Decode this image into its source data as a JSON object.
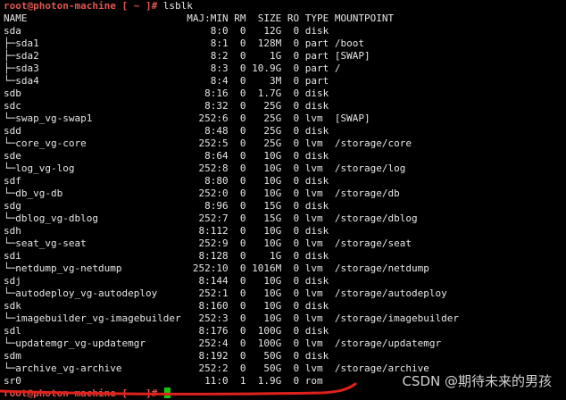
{
  "terminal": {
    "prompt": "root@photon-machine [ ~ ]#",
    "command": " lsblk",
    "final_prompt": "root@photon-machine [ ~ ]#",
    "columns": [
      "NAME",
      "MAJ:MIN",
      "RM",
      "SIZE",
      "RO",
      "TYPE",
      "MOUNTPOINT"
    ],
    "rows": [
      {
        "name": "sda",
        "majmin": "8:0",
        "rm": "0",
        "size": "12G",
        "ro": "0",
        "type": "disk",
        "mount": ""
      },
      {
        "name": "├─sda1",
        "majmin": "8:1",
        "rm": "0",
        "size": "128M",
        "ro": "0",
        "type": "part",
        "mount": "/boot"
      },
      {
        "name": "├─sda2",
        "majmin": "8:2",
        "rm": "0",
        "size": "1G",
        "ro": "0",
        "type": "part",
        "mount": "[SWAP]"
      },
      {
        "name": "├─sda3",
        "majmin": "8:3",
        "rm": "0",
        "size": "10.9G",
        "ro": "0",
        "type": "part",
        "mount": "/"
      },
      {
        "name": "└─sda4",
        "majmin": "8:4",
        "rm": "0",
        "size": "3M",
        "ro": "0",
        "type": "part",
        "mount": ""
      },
      {
        "name": "sdb",
        "majmin": "8:16",
        "rm": "0",
        "size": "1.7G",
        "ro": "0",
        "type": "disk",
        "mount": ""
      },
      {
        "name": "sdc",
        "majmin": "8:32",
        "rm": "0",
        "size": "25G",
        "ro": "0",
        "type": "disk",
        "mount": ""
      },
      {
        "name": "└─swap_vg-swap1",
        "majmin": "252:6",
        "rm": "0",
        "size": "25G",
        "ro": "0",
        "type": "lvm",
        "mount": "[SWAP]"
      },
      {
        "name": "sdd",
        "majmin": "8:48",
        "rm": "0",
        "size": "25G",
        "ro": "0",
        "type": "disk",
        "mount": ""
      },
      {
        "name": "└─core_vg-core",
        "majmin": "252:5",
        "rm": "0",
        "size": "25G",
        "ro": "0",
        "type": "lvm",
        "mount": "/storage/core"
      },
      {
        "name": "sde",
        "majmin": "8:64",
        "rm": "0",
        "size": "10G",
        "ro": "0",
        "type": "disk",
        "mount": ""
      },
      {
        "name": "└─log_vg-log",
        "majmin": "252:8",
        "rm": "0",
        "size": "10G",
        "ro": "0",
        "type": "lvm",
        "mount": "/storage/log"
      },
      {
        "name": "sdf",
        "majmin": "8:80",
        "rm": "0",
        "size": "10G",
        "ro": "0",
        "type": "disk",
        "mount": ""
      },
      {
        "name": "└─db_vg-db",
        "majmin": "252:0",
        "rm": "0",
        "size": "10G",
        "ro": "0",
        "type": "lvm",
        "mount": "/storage/db"
      },
      {
        "name": "sdg",
        "majmin": "8:96",
        "rm": "0",
        "size": "15G",
        "ro": "0",
        "type": "disk",
        "mount": ""
      },
      {
        "name": "└─dblog_vg-dblog",
        "majmin": "252:7",
        "rm": "0",
        "size": "15G",
        "ro": "0",
        "type": "lvm",
        "mount": "/storage/dblog"
      },
      {
        "name": "sdh",
        "majmin": "8:112",
        "rm": "0",
        "size": "10G",
        "ro": "0",
        "type": "disk",
        "mount": ""
      },
      {
        "name": "└─seat_vg-seat",
        "majmin": "252:9",
        "rm": "0",
        "size": "10G",
        "ro": "0",
        "type": "lvm",
        "mount": "/storage/seat"
      },
      {
        "name": "sdi",
        "majmin": "8:128",
        "rm": "0",
        "size": "1G",
        "ro": "0",
        "type": "disk",
        "mount": ""
      },
      {
        "name": "└─netdump_vg-netdump",
        "majmin": "252:10",
        "rm": "0",
        "size": "1016M",
        "ro": "0",
        "type": "lvm",
        "mount": "/storage/netdump"
      },
      {
        "name": "sdj",
        "majmin": "8:144",
        "rm": "0",
        "size": "10G",
        "ro": "0",
        "type": "disk",
        "mount": ""
      },
      {
        "name": "└─autodeploy_vg-autodeploy",
        "majmin": "252:1",
        "rm": "0",
        "size": "10G",
        "ro": "0",
        "type": "lvm",
        "mount": "/storage/autodeploy"
      },
      {
        "name": "sdk",
        "majmin": "8:160",
        "rm": "0",
        "size": "10G",
        "ro": "0",
        "type": "disk",
        "mount": ""
      },
      {
        "name": "└─imagebuilder_vg-imagebuilder",
        "majmin": "252:3",
        "rm": "0",
        "size": "10G",
        "ro": "0",
        "type": "lvm",
        "mount": "/storage/imagebuilder"
      },
      {
        "name": "sdl",
        "majmin": "8:176",
        "rm": "0",
        "size": "100G",
        "ro": "0",
        "type": "disk",
        "mount": ""
      },
      {
        "name": "└─updatemgr_vg-updatemgr",
        "majmin": "252:4",
        "rm": "0",
        "size": "100G",
        "ro": "0",
        "type": "lvm",
        "mount": "/storage/updatemgr"
      },
      {
        "name": "sdm",
        "majmin": "8:192",
        "rm": "0",
        "size": "50G",
        "ro": "0",
        "type": "disk",
        "mount": ""
      },
      {
        "name": "└─archive_vg-archive",
        "majmin": "252:2",
        "rm": "0",
        "size": "50G",
        "ro": "0",
        "type": "lvm",
        "mount": "/storage/archive"
      },
      {
        "name": "sr0",
        "majmin": "11:0",
        "rm": "1",
        "size": "1.9G",
        "ro": "0",
        "type": "rom",
        "mount": ""
      }
    ]
  },
  "watermark": "CSDN @期待未来的男孩",
  "colors": {
    "background": "#000000",
    "text": "#e6e6e6",
    "prompt": "#e0564f",
    "cursor": "#16c60c",
    "annotation": "#e0211b"
  }
}
